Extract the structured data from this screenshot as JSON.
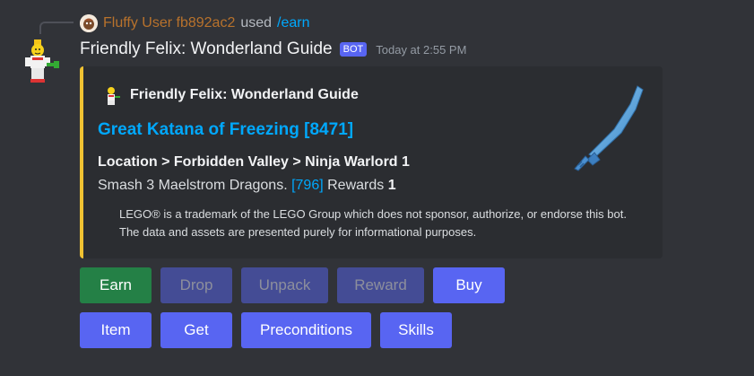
{
  "reply": {
    "avatar_icon": "user-avatar-icon",
    "user": "Fluffy User fb892ac2",
    "used_text": "used",
    "command": "/earn"
  },
  "message": {
    "avatar_icon": "lego-minifig-avatar-icon",
    "bot_name": "Friendly Felix: Wonderland Guide",
    "badge": "BOT",
    "timestamp": "Today at 2:55 PM"
  },
  "embed": {
    "accent_color": "#f0c232",
    "author_icon": "lego-minifig-icon",
    "author_name": "Friendly Felix: Wonderland Guide",
    "title": "Great Katana of Freezing [8471]",
    "field_name": "Location > Forbidden Valley > Ninja Warlord 1",
    "field_value_prefix": "Smash 3 Maelstrom Dragons. ",
    "field_value_link": "[796]",
    "field_value_suffix": " Rewards ",
    "field_value_count": "1",
    "disclaimer": "LEGO® is a trademark of the LEGO Group which does not sponsor, authorize, or endorse this bot. The data and assets are presented purely for informational purposes.",
    "thumbnail_icon": "ice-katana-icon"
  },
  "buttons_row1": [
    {
      "label": "Earn",
      "style": "success",
      "disabled": false
    },
    {
      "label": "Drop",
      "style": "primary",
      "disabled": true
    },
    {
      "label": "Unpack",
      "style": "primary",
      "disabled": true
    },
    {
      "label": "Reward",
      "style": "primary",
      "disabled": true
    },
    {
      "label": "Buy",
      "style": "primary",
      "disabled": false
    }
  ],
  "buttons_row2": [
    {
      "label": "Item",
      "style": "primary",
      "disabled": false
    },
    {
      "label": "Get",
      "style": "primary",
      "disabled": false
    },
    {
      "label": "Preconditions",
      "style": "primary",
      "disabled": false
    },
    {
      "label": "Skills",
      "style": "primary",
      "disabled": false
    }
  ],
  "colors": {
    "background": "#313338",
    "embed_bg": "#2b2d31",
    "link": "#00a8fc",
    "blurple": "#5865f2",
    "green": "#248046",
    "reply_user": "#b8722c"
  }
}
